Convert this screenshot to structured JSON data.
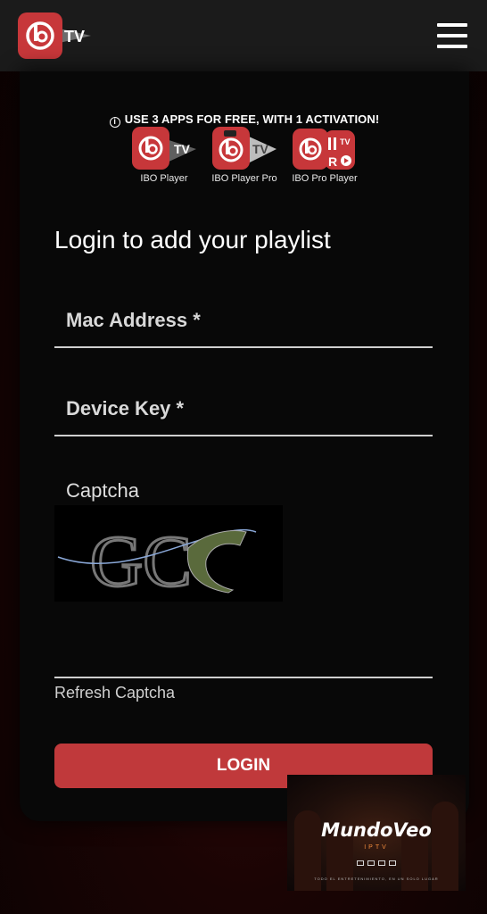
{
  "header": {
    "logo_text": "TV",
    "menu_icon": "hamburger-menu-icon"
  },
  "promo": {
    "text": "USE 3 APPS FOR FREE, WITH 1 ACTIVATION!",
    "icon": "info-icon"
  },
  "apps": [
    {
      "caption": "IBO Player",
      "badge": "TV"
    },
    {
      "caption": "IBO Player Pro",
      "badge": "TV"
    },
    {
      "caption": "IBO Pro Player",
      "badge": "TV"
    }
  ],
  "login": {
    "heading": "Login to add your playlist",
    "mac_placeholder": "Mac Address *",
    "key_placeholder": "Device Key *",
    "captcha_label": "Captcha",
    "captcha_chars": "GC",
    "refresh_label": "Refresh Captcha",
    "login_label": "LOGIN"
  },
  "ad": {
    "brand": "MundoVeo",
    "sub": "IPTV",
    "tagline": "TODO EL ENTRETENIMIENTO, EN UN SOLO LUGAR"
  },
  "colors": {
    "accent": "#c0393b",
    "logo_red": "#c7373a",
    "logo_grey": "#9a9a9a",
    "header_bg": "#1b1b1b"
  }
}
